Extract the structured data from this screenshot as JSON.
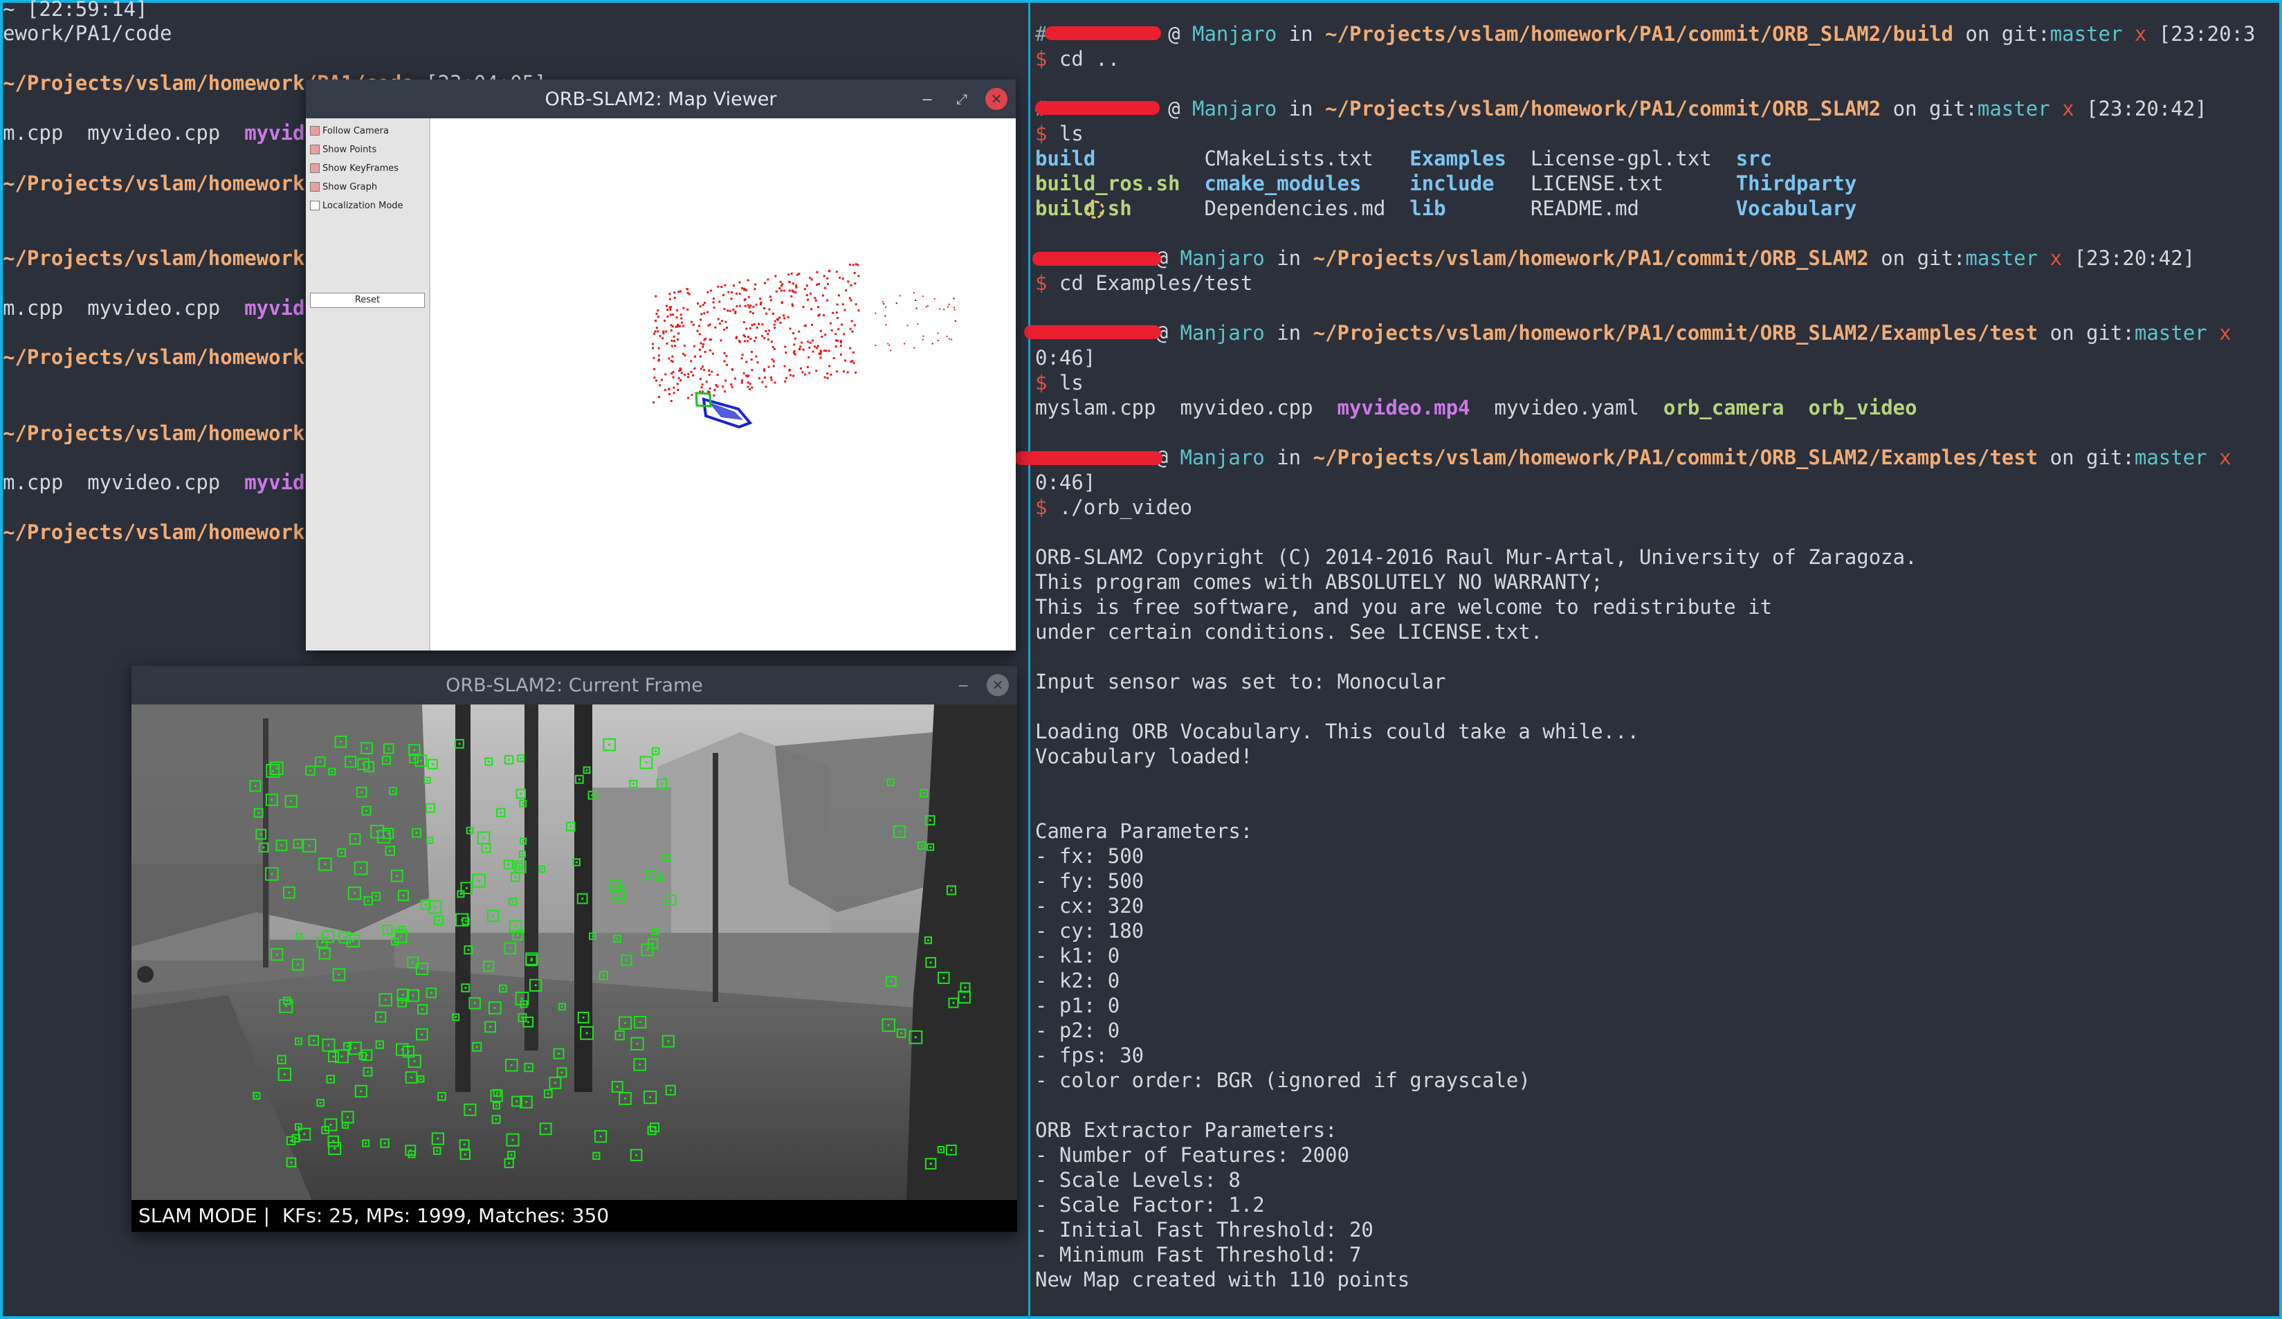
{
  "colors": {
    "screen_border": "#12b6e6",
    "terminal_bg": "#2b303b",
    "path": "#f2ab74",
    "branch": "#5cc4c9",
    "dirty": "#e5503d",
    "directory": "#7cc4f0",
    "executable": "#b6d47a",
    "media": "#cc78e6",
    "keypoint": "#1de21d",
    "map_point": "#e11b1b",
    "keyframe": "#1a22d6"
  },
  "left_terminal": {
    "lines": [
      {
        "segments": [
          {
            "text": "~ [22:59:14]",
            "color": "text"
          }
        ]
      },
      {
        "segments": [
          {
            "text": "ework/PA1/code",
            "color": "text"
          }
        ]
      },
      {
        "segments": [
          {
            "text": "~/Projects/vslam/homework/PA1/code",
            "color": "orange"
          },
          {
            "text": " [23:04:05]",
            "color": "text"
          }
        ]
      },
      {
        "segments": [
          {
            "text": "m.cpp  myvideo.cpp  ",
            "color": "text"
          },
          {
            "text": "myvideo.mp4",
            "color": "magenta"
          }
        ]
      },
      {
        "segments": [
          {
            "text": "~/Projects/vslam/homework/PA1/code",
            "color": "orange"
          }
        ]
      },
      {
        "segments": [
          {
            "text": "~/Projects/vslam/homework/PA1/code",
            "color": "orange"
          }
        ]
      },
      {
        "segments": [
          {
            "text": "m.cpp  myvideo.cpp  ",
            "color": "text"
          },
          {
            "text": "myvideo.mp4",
            "color": "magenta"
          }
        ]
      },
      {
        "segments": [
          {
            "text": "~/Projects/vslam/homework/PA1/code",
            "color": "orange"
          }
        ]
      },
      {
        "segments": [
          {
            "text": "~/Projects/vslam/homework/PA1/code",
            "color": "orange"
          }
        ]
      },
      {
        "segments": [
          {
            "text": "m.cpp  myvideo.cpp  ",
            "color": "text"
          },
          {
            "text": "myvideo.mp4",
            "color": "magenta"
          }
        ]
      },
      {
        "segments": [
          {
            "text": "~/Projects/vslam/homework/PA1/code",
            "color": "orange"
          }
        ]
      }
    ]
  },
  "right_terminal": {
    "lines": [
      {
        "segments": [
          {
            "text": "#",
            "color": "grey"
          },
          {
            "text": "          ",
            "color": "text"
          },
          {
            "text": "@ ",
            "color": "text"
          },
          {
            "text": "Manjaro",
            "color": "cyan"
          },
          {
            "text": " in ",
            "color": "text"
          },
          {
            "text": "~/Projects/vslam/homework/PA1/commit/ORB_SLAM2/build",
            "color": "orange"
          },
          {
            "text": " on git:",
            "color": "text"
          },
          {
            "text": "master",
            "color": "cyan"
          },
          {
            "text": " x",
            "color": "red"
          },
          {
            "text": " [23:20:3",
            "color": "text"
          }
        ]
      },
      {
        "segments": [
          {
            "text": "$ ",
            "color": "prompt"
          },
          {
            "text": "cd ..",
            "color": "text"
          }
        ]
      },
      {
        "segments": [
          {
            "text": "#",
            "color": "grey"
          },
          {
            "text": "          ",
            "color": "text"
          },
          {
            "text": "@ ",
            "color": "text"
          },
          {
            "text": "Manjaro",
            "color": "cyan"
          },
          {
            "text": " in ",
            "color": "text"
          },
          {
            "text": "~/Projects/vslam/homework/PA1/commit/ORB_SLAM2",
            "color": "orange"
          },
          {
            "text": " on git:",
            "color": "text"
          },
          {
            "text": "master",
            "color": "cyan"
          },
          {
            "text": " x",
            "color": "red"
          },
          {
            "text": " [23:20:42]",
            "color": "text"
          }
        ]
      },
      {
        "segments": [
          {
            "text": "$ ",
            "color": "prompt"
          },
          {
            "text": "ls",
            "color": "text"
          }
        ]
      },
      {
        "segments": [
          {
            "text": "build",
            "color": "blue"
          },
          {
            "text": "         CMakeLists.txt   ",
            "color": "text"
          },
          {
            "text": "Examples",
            "color": "blue"
          },
          {
            "text": "  License-gpl.txt  ",
            "color": "text"
          },
          {
            "text": "src",
            "color": "blue"
          }
        ]
      },
      {
        "segments": [
          {
            "text": "build_ros.sh",
            "color": "green"
          },
          {
            "text": "  ",
            "color": "text"
          },
          {
            "text": "cmake_modules",
            "color": "blue"
          },
          {
            "text": "    ",
            "color": "text"
          },
          {
            "text": "include",
            "color": "blue"
          },
          {
            "text": "   LICENSE.txt      ",
            "color": "text"
          },
          {
            "text": "Thirdparty",
            "color": "blue"
          }
        ]
      },
      {
        "segments": [
          {
            "text": "build.sh",
            "color": "green"
          },
          {
            "text": "      Dependencies.md  ",
            "color": "text"
          },
          {
            "text": "lib",
            "color": "blue"
          },
          {
            "text": "       README.md        ",
            "color": "text"
          },
          {
            "text": "Vocabulary",
            "color": "blue"
          }
        ]
      },
      {
        "segments": [
          {
            "text": "          ",
            "color": "text"
          },
          {
            "text": "@ ",
            "color": "text"
          },
          {
            "text": "Manjaro",
            "color": "cyan"
          },
          {
            "text": " in ",
            "color": "text"
          },
          {
            "text": "~/Projects/vslam/homework/PA1/commit/ORB_SLAM2",
            "color": "orange"
          },
          {
            "text": " on git:",
            "color": "text"
          },
          {
            "text": "master",
            "color": "cyan"
          },
          {
            "text": " x",
            "color": "red"
          },
          {
            "text": " [23:20:42]",
            "color": "text"
          }
        ]
      },
      {
        "segments": [
          {
            "text": "$ ",
            "color": "prompt"
          },
          {
            "text": "cd Examples/test",
            "color": "text"
          }
        ]
      },
      {
        "segments": [
          {
            "text": "          ",
            "color": "text"
          },
          {
            "text": "@ ",
            "color": "text"
          },
          {
            "text": "Manjaro",
            "color": "cyan"
          },
          {
            "text": " in ",
            "color": "text"
          },
          {
            "text": "~/Projects/vslam/homework/PA1/commit/ORB_SLAM2/Examples/test",
            "color": "orange"
          },
          {
            "text": " on git:",
            "color": "text"
          },
          {
            "text": "master",
            "color": "cyan"
          },
          {
            "text": " x",
            "color": "red"
          }
        ]
      },
      {
        "segments": [
          {
            "text": "0:46]",
            "color": "text"
          }
        ]
      },
      {
        "segments": [
          {
            "text": "$ ",
            "color": "prompt"
          },
          {
            "text": "ls",
            "color": "text"
          }
        ]
      },
      {
        "segments": [
          {
            "text": "myslam.cpp  myvideo.cpp  ",
            "color": "text"
          },
          {
            "text": "myvideo.mp4",
            "color": "magenta"
          },
          {
            "text": "  myvideo.yaml  ",
            "color": "text"
          },
          {
            "text": "orb_camera",
            "color": "green"
          },
          {
            "text": "  ",
            "color": "text"
          },
          {
            "text": "orb_video",
            "color": "green"
          }
        ]
      },
      {
        "segments": [
          {
            "text": "          ",
            "color": "text"
          },
          {
            "text": "@ ",
            "color": "text"
          },
          {
            "text": "Manjaro",
            "color": "cyan"
          },
          {
            "text": " in ",
            "color": "text"
          },
          {
            "text": "~/Projects/vslam/homework/PA1/commit/ORB_SLAM2/Examples/test",
            "color": "orange"
          },
          {
            "text": " on git:",
            "color": "text"
          },
          {
            "text": "master",
            "color": "cyan"
          },
          {
            "text": " x",
            "color": "red"
          }
        ]
      },
      {
        "segments": [
          {
            "text": "0:46]",
            "color": "text"
          }
        ]
      },
      {
        "segments": [
          {
            "text": "$ ",
            "color": "prompt"
          },
          {
            "text": "./orb_video",
            "color": "text"
          }
        ]
      },
      {
        "segments": [
          {
            "text": "ORB-SLAM2 Copyright (C) 2014-2016 Raul Mur-Artal, University of Zaragoza.",
            "color": "text"
          }
        ]
      },
      {
        "segments": [
          {
            "text": "This program comes with ABSOLUTELY NO WARRANTY;",
            "color": "text"
          }
        ]
      },
      {
        "segments": [
          {
            "text": "This is free software, and you are welcome to redistribute it",
            "color": "text"
          }
        ]
      },
      {
        "segments": [
          {
            "text": "under certain conditions. See LICENSE.txt.",
            "color": "text"
          }
        ]
      },
      {
        "segments": [
          {
            "text": "Input sensor was set to: Monocular",
            "color": "text"
          }
        ]
      },
      {
        "segments": [
          {
            "text": "Loading ORB Vocabulary. This could take a while...",
            "color": "text"
          }
        ]
      },
      {
        "segments": [
          {
            "text": "Vocabulary loaded!",
            "color": "text"
          }
        ]
      },
      {
        "segments": [
          {
            "text": "Camera Parameters:",
            "color": "text"
          }
        ]
      },
      {
        "segments": [
          {
            "text": "- fx: 500",
            "color": "text"
          }
        ]
      },
      {
        "segments": [
          {
            "text": "- fy: 500",
            "color": "text"
          }
        ]
      },
      {
        "segments": [
          {
            "text": "- cx: 320",
            "color": "text"
          }
        ]
      },
      {
        "segments": [
          {
            "text": "- cy: 180",
            "color": "text"
          }
        ]
      },
      {
        "segments": [
          {
            "text": "- k1: 0",
            "color": "text"
          }
        ]
      },
      {
        "segments": [
          {
            "text": "- k2: 0",
            "color": "text"
          }
        ]
      },
      {
        "segments": [
          {
            "text": "- p1: 0",
            "color": "text"
          }
        ]
      },
      {
        "segments": [
          {
            "text": "- p2: 0",
            "color": "text"
          }
        ]
      },
      {
        "segments": [
          {
            "text": "- fps: 30",
            "color": "text"
          }
        ]
      },
      {
        "segments": [
          {
            "text": "- color order: BGR (ignored if grayscale)",
            "color": "text"
          }
        ]
      },
      {
        "segments": [
          {
            "text": "ORB Extractor Parameters:",
            "color": "text"
          }
        ]
      },
      {
        "segments": [
          {
            "text": "- Number of Features: 2000",
            "color": "text"
          }
        ]
      },
      {
        "segments": [
          {
            "text": "- Scale Levels: 8",
            "color": "text"
          }
        ]
      },
      {
        "segments": [
          {
            "text": "- Scale Factor: 1.2",
            "color": "text"
          }
        ]
      },
      {
        "segments": [
          {
            "text": "- Initial Fast Threshold: 20",
            "color": "text"
          }
        ]
      },
      {
        "segments": [
          {
            "text": "- Minimum Fast Threshold: 7",
            "color": "text"
          }
        ]
      },
      {
        "segments": [
          {
            "text": "New Map created with 110 points",
            "color": "text"
          }
        ]
      }
    ]
  },
  "map_viewer": {
    "title": "ORB-SLAM2: Map Viewer",
    "minimize_icon": "minimize-icon",
    "maximize_icon": "maximize-icon",
    "close_icon": "close-icon",
    "options": [
      {
        "label": "Follow Camera",
        "checked": true
      },
      {
        "label": "Show Points",
        "checked": true
      },
      {
        "label": "Show KeyFrames",
        "checked": true
      },
      {
        "label": "Show Graph",
        "checked": true
      },
      {
        "label": "Localization Mode",
        "checked": false
      }
    ],
    "reset_label": "Reset"
  },
  "current_frame": {
    "title": "ORB-SLAM2: Current Frame",
    "minimize_icon": "minimize-icon",
    "close_icon": "close-icon",
    "status": "SLAM MODE |  KFs: 25, MPs: 1999, Matches: 350"
  }
}
